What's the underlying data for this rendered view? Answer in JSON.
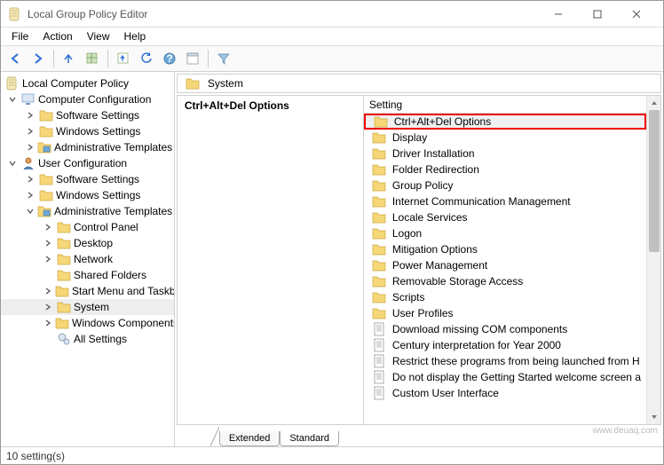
{
  "window": {
    "title": "Local Group Policy Editor"
  },
  "menu": [
    "File",
    "Action",
    "View",
    "Help"
  ],
  "tree": {
    "root": "Local Computer Policy",
    "cc": "Computer Configuration",
    "cc_software": "Software Settings",
    "cc_windows": "Windows Settings",
    "cc_admin": "Administrative Templates",
    "uc": "User Configuration",
    "uc_software": "Software Settings",
    "uc_windows": "Windows Settings",
    "uc_admin": "Administrative Templates",
    "uc_cp": "Control Panel",
    "uc_desktop": "Desktop",
    "uc_network": "Network",
    "uc_shared": "Shared Folders",
    "uc_start": "Start Menu and Taskbar",
    "uc_system": "System",
    "uc_wincomp": "Windows Components",
    "uc_all": "All Settings"
  },
  "header": {
    "folder": "System"
  },
  "left_pane": {
    "title": "Ctrl+Alt+Del Options"
  },
  "list": {
    "col": "Setting",
    "items": [
      "Ctrl+Alt+Del Options",
      "Display",
      "Driver Installation",
      "Folder Redirection",
      "Group Policy",
      "Internet Communication Management",
      "Locale Services",
      "Logon",
      "Mitigation Options",
      "Power Management",
      "Removable Storage Access",
      "Scripts",
      "User Profiles",
      "Download missing COM components",
      "Century interpretation for Year 2000",
      "Restrict these programs from being launched from H",
      "Do not display the Getting Started welcome screen a",
      "Custom User Interface"
    ]
  },
  "tabs": {
    "extended": "Extended",
    "standard": "Standard"
  },
  "status": "10 setting(s)",
  "watermark": "www.deuaq.com"
}
